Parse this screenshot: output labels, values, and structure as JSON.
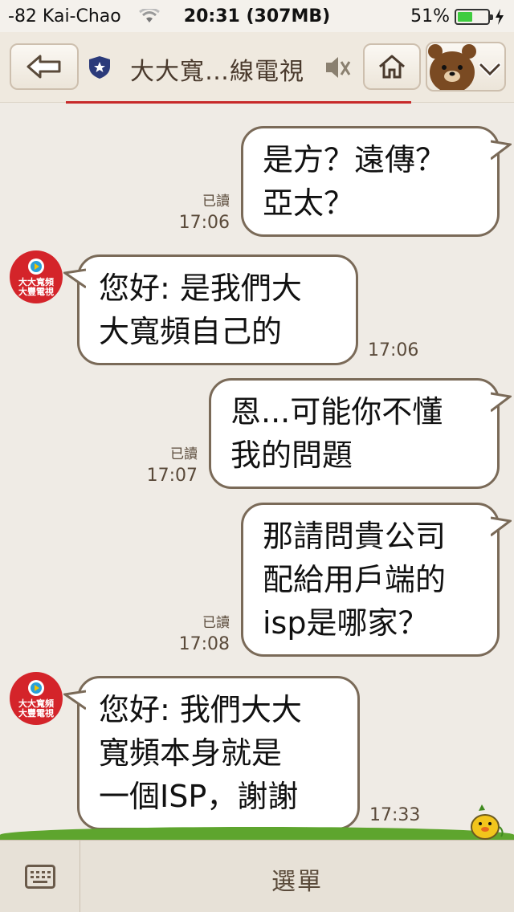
{
  "status_bar": {
    "carrier": "-82 Kai-Chao",
    "time": "20:31 (307MB)",
    "battery": "51%",
    "battery_level": 0.51,
    "icons": [
      "wifi-icon",
      "battery-icon",
      "charging-bolt-icon"
    ]
  },
  "header": {
    "title": "大大寬…線電視",
    "icons": [
      "back-arrow-icon",
      "shield-star-icon",
      "speaker-muted-icon",
      "home-icon",
      "bear-avatar-icon",
      "chevron-down-icon"
    ]
  },
  "messages": [
    {
      "side": "right",
      "text": "是方？遠傳？\n亞太？",
      "read": "已讀",
      "time": "17:06"
    },
    {
      "side": "left",
      "text": "您好: 是我們大\n大寬頻自己的",
      "time": "17:06",
      "avatar_text": "大大寬頻\n大豐電視"
    },
    {
      "side": "right",
      "text": "恩...可能你不懂\n我的問題",
      "read": "已讀",
      "time": "17:07"
    },
    {
      "side": "right",
      "text": "那請問貴公司\n配給用戶端的\nisp是哪家？",
      "read": "已讀",
      "time": "17:08"
    },
    {
      "side": "left",
      "text": "您好: 我們大大\n寬頻本身就是\n一個ISP，謝謝",
      "time": "17:33",
      "avatar_text": "大大寬頻\n大豐電視"
    }
  ],
  "bottom_bar": {
    "menu_label": "選單",
    "icons": [
      "keyboard-icon"
    ]
  },
  "colors": {
    "background": "#efebe5",
    "bubble_border": "#7a6a58",
    "avatar_red": "#d4242a",
    "grass_green": "#5ea52e"
  }
}
